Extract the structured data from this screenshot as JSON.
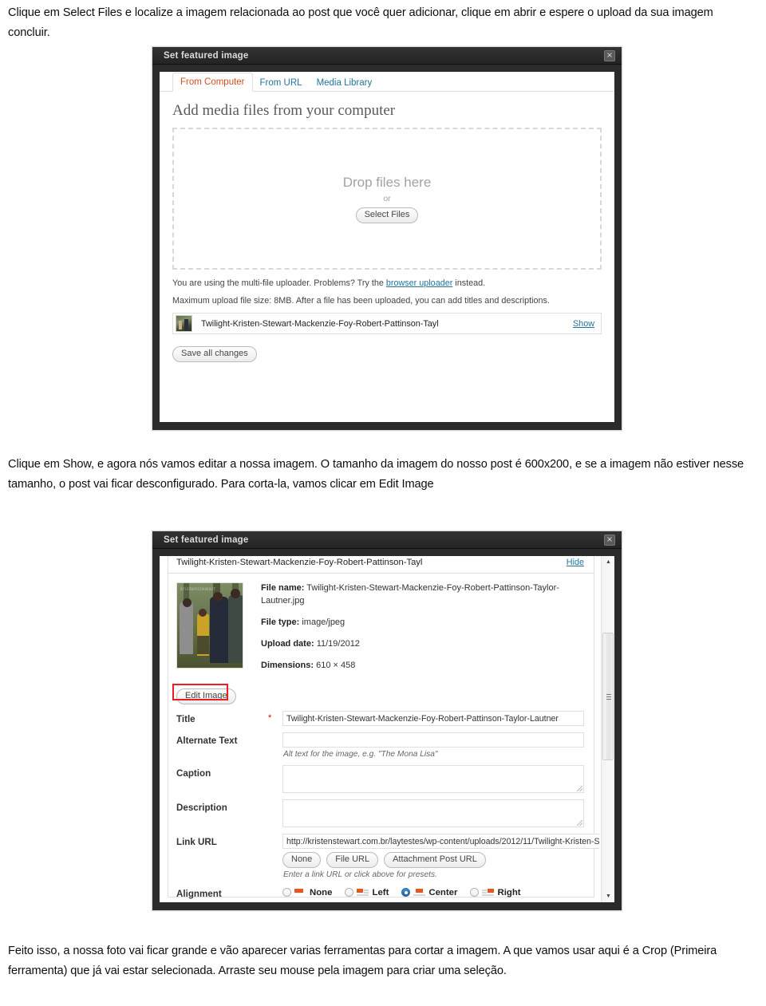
{
  "document": {
    "paragraph_top": "Clique em Select Files e localize a imagem relacionada ao post que você quer adicionar, clique em abrir e espere o upload da sua imagem concluir.",
    "paragraph_middle": "Clique em Show, e agora nós vamos editar a nossa imagem. O tamanho da imagem do nosso post é 600x200, e se a imagem não estiver nesse tamanho, o post vai ficar desconfigurado. Para corta-la, vamos clicar em Edit Image",
    "paragraph_bottom": "Feito isso, a nossa foto vai ficar grande e vão aparecer varias ferramentas para cortar a imagem. A que vamos usar aqui é a Crop (Primeira ferramenta) que já vai estar selecionada. Arraste seu mouse pela imagem para criar uma seleção."
  },
  "dialog1": {
    "title": "Set featured image",
    "close_label": "×",
    "tabs": [
      {
        "label": "From Computer",
        "active": true
      },
      {
        "label": "From URL",
        "active": false
      },
      {
        "label": "Media Library",
        "active": false
      }
    ],
    "heading": "Add media files from your computer",
    "dropzone": {
      "main_text": "Drop files here",
      "or_text": "or",
      "select_button": "Select Files"
    },
    "note_uploader_pre": "You are using the multi-file uploader. Problems? Try the ",
    "note_uploader_link": "browser uploader",
    "note_uploader_post": " instead.",
    "note_maxsize": "Maximum upload file size: 8MB. After a file has been uploaded, you can add titles and descriptions.",
    "file_row": {
      "name": "Twilight-Kristen-Stewart-Mackenzie-Foy-Robert-Pattinson-Tayl",
      "toggle_link": "Show"
    },
    "save_button": "Save all changes"
  },
  "dialog2": {
    "title": "Set featured image",
    "close_label": "×",
    "attachment_title": "Twilight-Kristen-Stewart-Mackenzie-Foy-Robert-Pattinson-Tayl",
    "toggle_link": "Hide",
    "meta": {
      "file_name_label": "File name:",
      "file_name_value": "Twilight-Kristen-Stewart-Mackenzie-Foy-Robert-Pattinson-Taylor-Lautner.jpg",
      "file_type_label": "File type:",
      "file_type_value": "image/jpeg",
      "upload_date_label": "Upload date:",
      "upload_date_value": "11/19/2012",
      "dimensions_label": "Dimensions:",
      "dimensions_value": "610 × 458"
    },
    "edit_image_button": "Edit Image",
    "highlight_color": "#ec1c24",
    "fields": {
      "title_label": "Title",
      "title_required": "*",
      "title_value": "Twilight-Kristen-Stewart-Mackenzie-Foy-Robert-Pattinson-Taylor-Lautner",
      "alt_label": "Alternate Text",
      "alt_value": "",
      "alt_hint": "Alt text for the image, e.g. \"The Mona Lisa\"",
      "caption_label": "Caption",
      "caption_value": "",
      "description_label": "Description",
      "description_value": "",
      "link_url_label": "Link URL",
      "link_url_value": "http://kristenstewart.com.br/laytestes/wp-content/uploads/2012/11/Twilight-Kristen-S",
      "link_buttons": [
        "None",
        "File URL",
        "Attachment Post URL"
      ],
      "link_hint": "Enter a link URL or click above for presets.",
      "alignment_label": "Alignment",
      "alignment_options": [
        {
          "label": "None",
          "selected": false
        },
        {
          "label": "Left",
          "selected": false
        },
        {
          "label": "Center",
          "selected": true
        },
        {
          "label": "Right",
          "selected": false
        }
      ]
    },
    "scrollbar": {
      "up_arrow": "▲",
      "down_arrow": "▼"
    }
  }
}
